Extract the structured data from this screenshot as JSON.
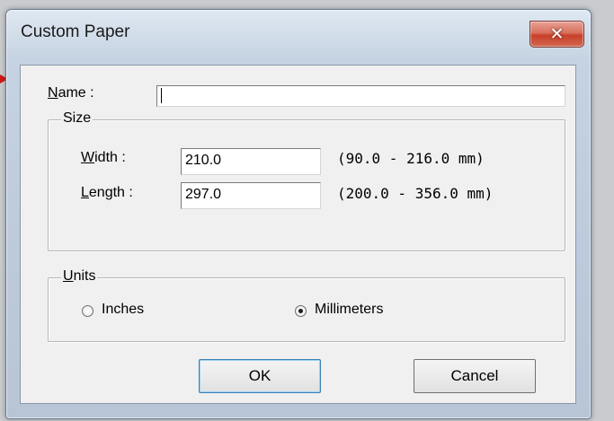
{
  "window": {
    "title": "Custom Paper",
    "close_glyph": "✕"
  },
  "name": {
    "label_first": "N",
    "label_rest": "ame :",
    "value": ""
  },
  "size": {
    "legend": "Size",
    "width": {
      "label_first": "W",
      "label_rest": "idth :",
      "value": "210.0",
      "range": "(90.0 - 216.0 mm)"
    },
    "length": {
      "label_first": "L",
      "label_rest": "ength :",
      "value": "297.0",
      "range": "(200.0 - 356.0 mm)"
    }
  },
  "units": {
    "legend_first": "U",
    "legend_rest": "nits",
    "options": [
      {
        "label": "Inches",
        "selected": false
      },
      {
        "label": "Millimeters",
        "selected": true
      }
    ]
  },
  "buttons": {
    "ok": "OK",
    "cancel": "Cancel"
  },
  "colors": {
    "close_button": "#c8402a",
    "desktop_arrow": "#d01a1a"
  }
}
